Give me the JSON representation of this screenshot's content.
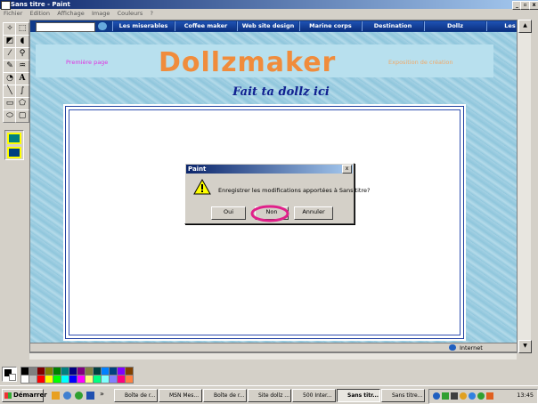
{
  "window": {
    "title": "Sans titre - Paint",
    "min": "_",
    "max": "▫",
    "close": "x"
  },
  "menu": [
    "Fichier",
    "Edition",
    "Affichage",
    "Image",
    "Couleurs",
    "?"
  ],
  "browser_nav": {
    "tabs": [
      "Les miserables",
      "Coffee maker",
      "Web site design",
      "Marine corps",
      "Destination",
      "Dollz",
      "Les"
    ]
  },
  "banner": {
    "left_link": "Première page",
    "logo": "Dollzmaker",
    "right_text": "Exposition de création"
  },
  "subtitle": "Fait ta dollz ici",
  "ie_status": {
    "zone": "Internet"
  },
  "dialog": {
    "title": "Paint",
    "message": "Enregistrer les modifications apportées à Sans titre?",
    "buttons": {
      "yes": "Oui",
      "no": "Non",
      "cancel": "Annuler"
    },
    "highlight_color": "#e0208a"
  },
  "palette_colors": [
    "#000000",
    "#808080",
    "#800000",
    "#808000",
    "#008000",
    "#008080",
    "#000080",
    "#800080",
    "#808040",
    "#004040",
    "#0080ff",
    "#004080",
    "#8000ff",
    "#804000",
    "#ffffff",
    "#c0c0c0",
    "#ff0000",
    "#ffff00",
    "#00ff00",
    "#00ffff",
    "#0000ff",
    "#ff00ff",
    "#ffff80",
    "#00ff80",
    "#80ffff",
    "#8080ff",
    "#ff0080",
    "#ff8040"
  ],
  "taskbar": {
    "start": "Démarrer",
    "tasks": [
      "Boîte de r...",
      "MSN Mes...",
      "Boîte de r...",
      "Site dollz ...",
      "500 Inter...",
      "Sans titr...",
      "Sans titre..."
    ],
    "clock": "13:45"
  }
}
